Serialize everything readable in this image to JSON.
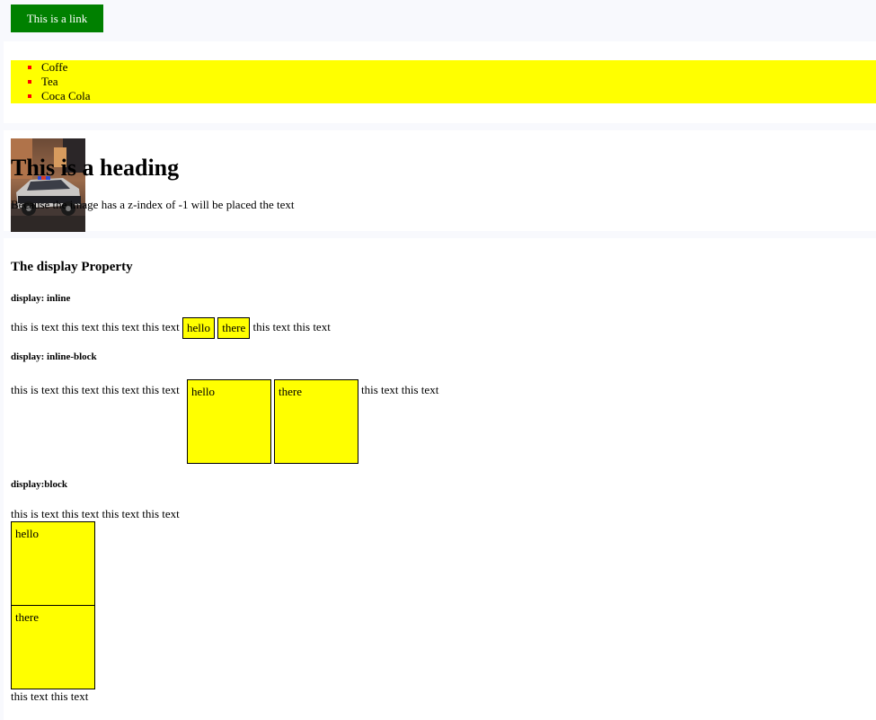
{
  "link": {
    "label": "This is a link"
  },
  "drinks": [
    "Coffe",
    "Tea",
    "Coca Cola"
  ],
  "zindex": {
    "heading": "This is a heading",
    "text": "Because the image has a z-index of -1 will be placed the text"
  },
  "display": {
    "title": "The display Property",
    "inline": {
      "label": "display: inline",
      "before": "this is text this text this text this text",
      "box1": "hello",
      "box2": "there",
      "after": "this text this text"
    },
    "inline_block": {
      "label": "display: inline-block",
      "before": "this is text this text this text this text",
      "box1": "hello",
      "box2": "there",
      "after": "this text this text"
    },
    "block": {
      "label": "display:block",
      "before": "this is text this text this text this text",
      "box1": "hello",
      "box2": "there",
      "after": "this text this text"
    }
  },
  "colors": {
    "link_bg": "#008000",
    "highlight": "#ffff00",
    "marker": "#ff0000"
  }
}
